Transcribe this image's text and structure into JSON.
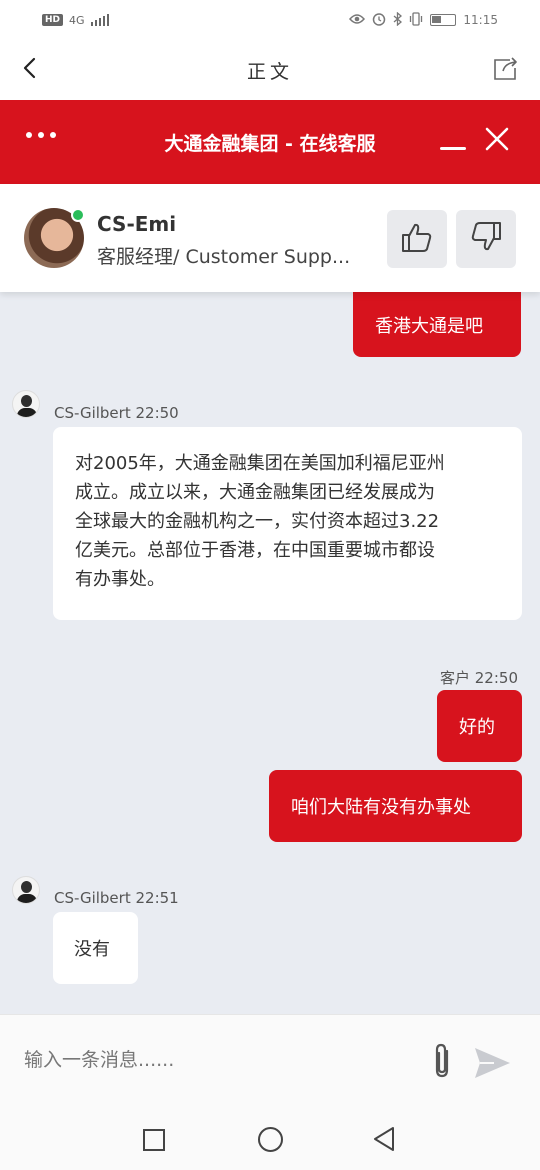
{
  "status_bar": {
    "hd": "HD",
    "network": "4G",
    "time": "11:15"
  },
  "browser": {
    "title": "正文"
  },
  "chat_header": {
    "title": "大通金融集团 - 在线客服"
  },
  "agent": {
    "name": "CS-Emi",
    "role": "客服经理/ Customer Supp..."
  },
  "messages": {
    "m1": {
      "text": "香港大通是吧"
    },
    "m2": {
      "sender": "CS-Gilbert 22:50",
      "lines": [
        "对2005年，大通金融集团在美国加利福尼亚州",
        "成立。成立以来，大通金融集团已经发展成为",
        "全球最大的金融机构之一，实付资本超过3.22",
        "亿美元。总部位于香港，在中国重要城市都设",
        "有办事处。"
      ]
    },
    "m3": {
      "sender": "客户 22:50",
      "text": "好的"
    },
    "m4": {
      "text": "咱们大陆有没有办事处"
    },
    "m5": {
      "sender": "CS-Gilbert 22:51",
      "text": "没有"
    }
  },
  "input": {
    "placeholder": "输入一条消息......"
  },
  "colors": {
    "brand_red": "#d7131d",
    "chat_bg": "#e9ecf2",
    "online": "#2bbd5a"
  },
  "icons": [
    "back-arrow-icon",
    "share-icon",
    "more-dots-icon",
    "minimize-icon",
    "close-icon",
    "thumbs-up-icon",
    "thumbs-down-icon",
    "attachment-icon",
    "send-icon",
    "nav-recents-icon",
    "nav-home-icon",
    "nav-back-icon"
  ]
}
